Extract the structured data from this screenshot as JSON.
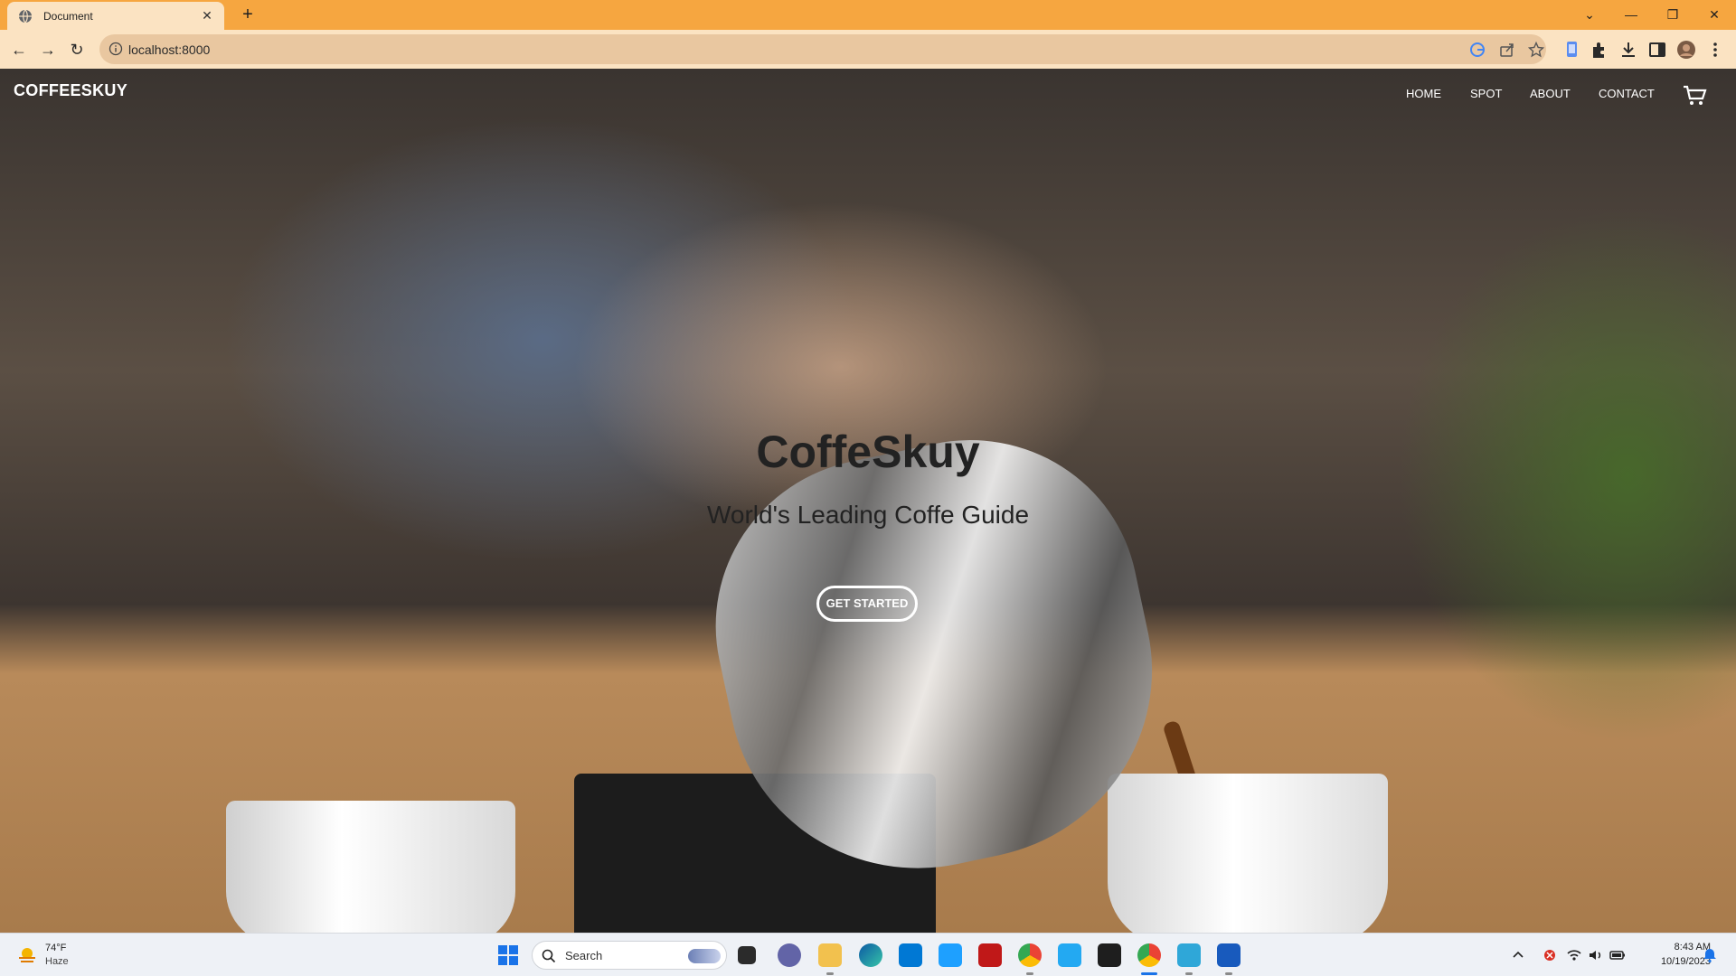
{
  "browser": {
    "tab_title": "Document",
    "tab_close": "✕",
    "new_tab": "+",
    "url": "localhost:8000",
    "window_controls": {
      "collapse": "⌄",
      "minimize": "—",
      "restore": "❐",
      "close": "✕"
    },
    "nav": {
      "back": "←",
      "forward": "→",
      "reload": "↻"
    },
    "theme_color": "#f6a640"
  },
  "site": {
    "brand": "COFFEESKUY",
    "menu": [
      "HOME",
      "SPOT",
      "ABOUT",
      "CONTACT"
    ],
    "hero_title": "CoffeSkuy",
    "hero_subtitle": "World's Leading Coffe Guide",
    "cta_label": "GET STARTED"
  },
  "taskbar": {
    "weather_temp": "74°F",
    "weather_condition": "Haze",
    "search_placeholder": "Search",
    "time": "8:43 AM",
    "date": "10/19/2023"
  }
}
